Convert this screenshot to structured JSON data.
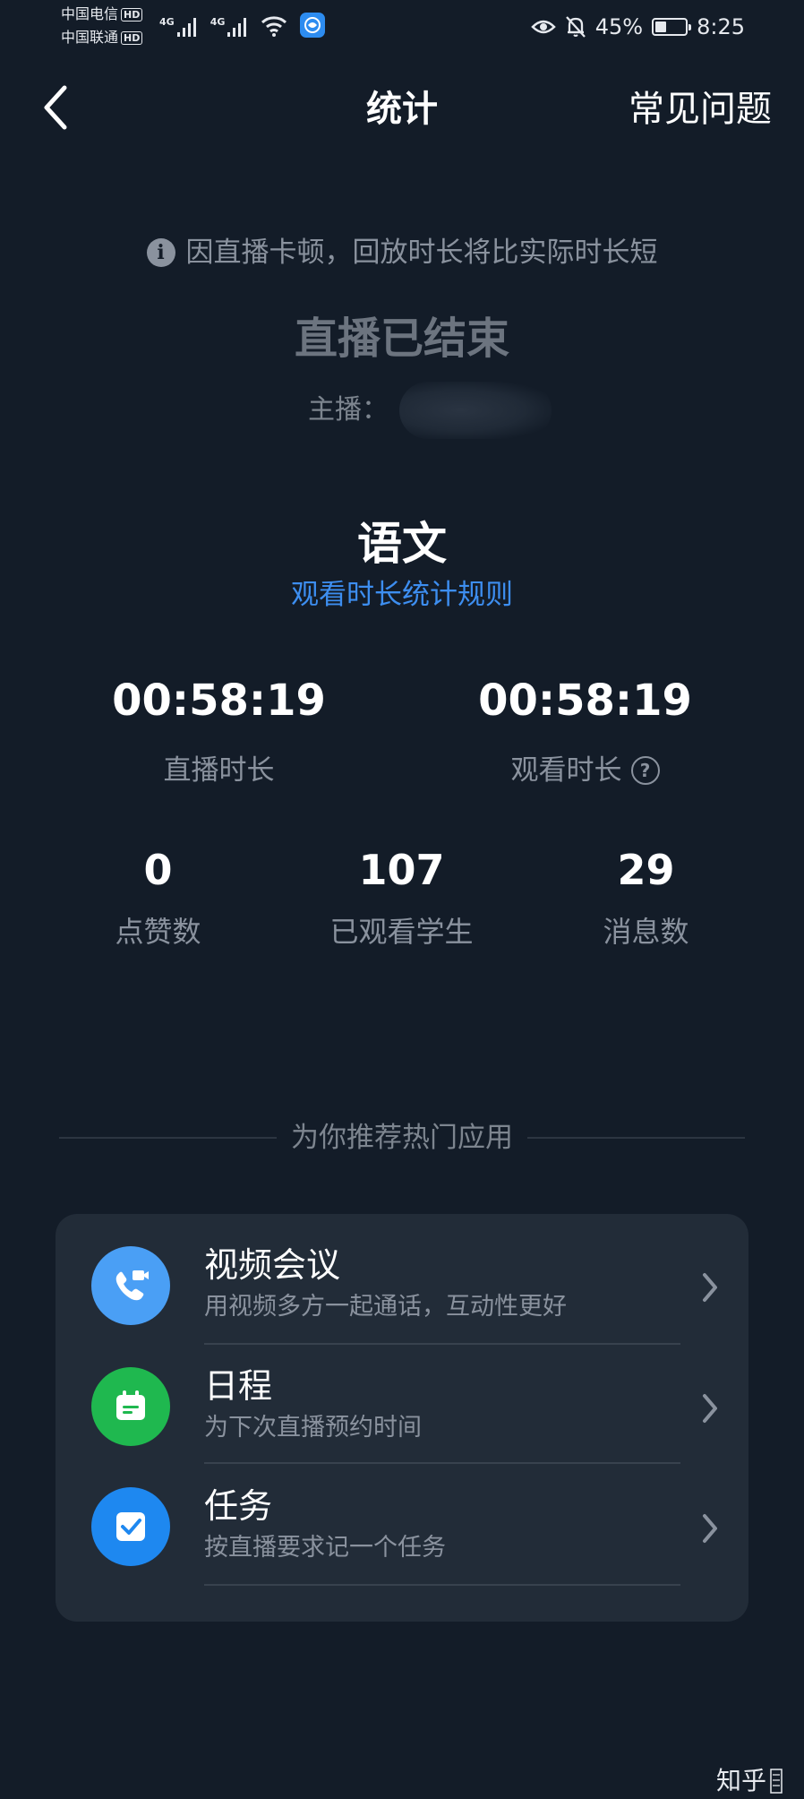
{
  "status_bar": {
    "carrier_1": "中国电信",
    "carrier_2": "中国联通",
    "hd_badge": "HD",
    "network_type": "4G",
    "battery_percent": "45%",
    "battery_level": 0.45,
    "time": "8:25"
  },
  "nav": {
    "title": "统计",
    "faq_label": "常见问题"
  },
  "notice": {
    "text": "因直播卡顿，回放时长将比实际时长短"
  },
  "live": {
    "status": "直播已结束",
    "host_label": "主播："
  },
  "subject": {
    "name": "语文",
    "rules_link": "观看时长统计规则"
  },
  "stats_primary": [
    {
      "value": "00:58:19",
      "label": "直播时长"
    },
    {
      "value": "00:58:19",
      "label": "观看时长"
    }
  ],
  "stats_secondary": [
    {
      "value": "0",
      "label": "点赞数"
    },
    {
      "value": "107",
      "label": "已观看学生"
    },
    {
      "value": "29",
      "label": "消息数"
    }
  ],
  "recommend": {
    "header": "为你推荐热门应用",
    "apps": [
      {
        "name": "视频会议",
        "desc": "用视频多方一起通话，互动性更好",
        "icon": "video-call-icon",
        "color": "#4a9ff5"
      },
      {
        "name": "日程",
        "desc": "为下次直播预约时间",
        "icon": "calendar-icon",
        "color": "#1fb84f"
      },
      {
        "name": "任务",
        "desc": "按直播要求记一个任务",
        "icon": "task-check-icon",
        "color": "#1e88f0"
      }
    ]
  },
  "watermark": {
    "text": "知乎"
  }
}
